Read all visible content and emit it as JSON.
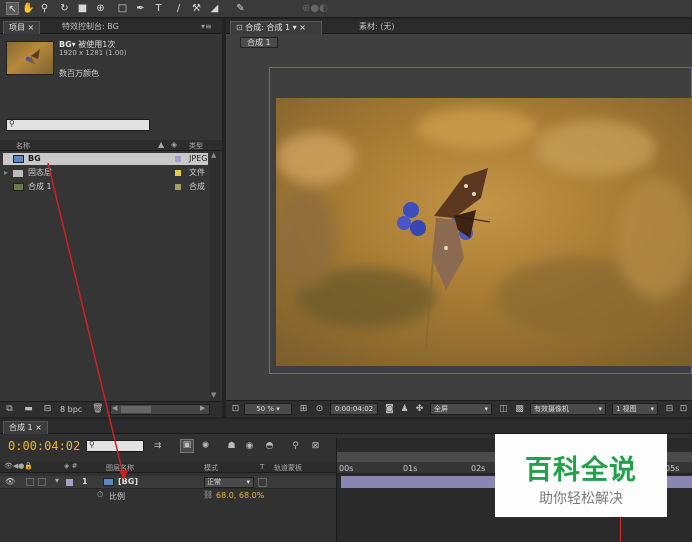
{
  "toolbar": {
    "icons": [
      "selection-tool-icon",
      "hand-tool-icon",
      "zoom-tool-icon",
      "rotate-tool-icon",
      "camera-tool-icon",
      "pan-behind-tool-icon",
      "mask-tool-icon",
      "pen-tool-icon",
      "type-tool-icon",
      "brush-tool-icon",
      "clone-tool-icon",
      "eraser-tool-icon",
      "puppet-tool-icon"
    ]
  },
  "project_panel": {
    "tabs": [
      "项目",
      "特效控制台: BG"
    ],
    "preview": {
      "name": "BG▾",
      "usage": "被使用1次",
      "dims": "1920 x 1281 (1.00)",
      "color": "数百万颜色"
    },
    "search_placeholder": "",
    "col_name": "名称",
    "col_type": "类型",
    "items": [
      {
        "name": "BG",
        "type": "JPEG",
        "color": "#a6a0c8"
      },
      {
        "name": "固态层",
        "type": "文件",
        "color": "#e6cc3a"
      },
      {
        "name": "合成 1",
        "type": "合成",
        "color": "#a69a6a"
      }
    ],
    "bpc": "8 bpc"
  },
  "comp_panel": {
    "tabs": [
      "合成: 合成 1",
      "素材: (无)"
    ],
    "crumb": "合成 1",
    "bottom": {
      "zoom": "50 %",
      "timecode": "0:00:04:02",
      "resolution": "全屏",
      "camera": "有效摄像机",
      "views": "1 视图"
    }
  },
  "timeline": {
    "tab": "合成 1",
    "timecode": "0:00:04:02",
    "search_placeholder": "",
    "headers": {
      "source": "图层名称",
      "mode": "模式",
      "t": "T",
      "trkmat": "轨道蒙板"
    },
    "layer": {
      "num": "1",
      "name": "[BG]",
      "mode": "正常"
    },
    "prop": {
      "name": "比例",
      "value": "68.0, 68.0%"
    },
    "ruler": [
      "00s",
      "01s",
      "02s",
      "05s"
    ]
  },
  "watermark": {
    "title": "百科全说",
    "subtitle": "助你轻松解决"
  }
}
